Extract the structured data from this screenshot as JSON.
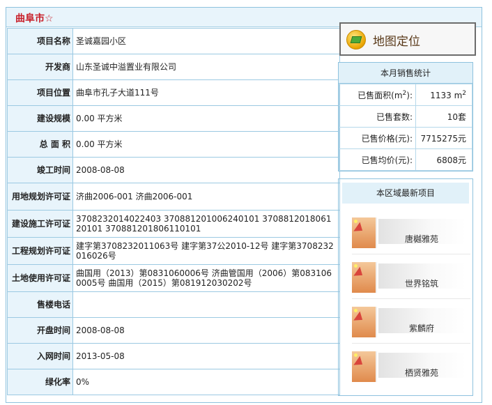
{
  "page": {
    "title": "曲阜市☆"
  },
  "info_rows": [
    {
      "label": "项目名称",
      "value": "圣诚嘉园小区"
    },
    {
      "label": "开发商",
      "value": "山东圣诚中溢置业有限公司"
    },
    {
      "label": "项目位置",
      "value": "曲阜市孔子大道111号"
    },
    {
      "label": "建设规模",
      "value": "0.00 平方米"
    },
    {
      "label": "总 面 积",
      "value": "0.00 平方米"
    },
    {
      "label": "竣工时间",
      "value": "2008-08-08"
    },
    {
      "label": "用地规划许可证",
      "value": "济曲2006-001 济曲2006-001"
    },
    {
      "label": "建设施工许可证",
      "value": "3708232014022403 370881201006240101 370881201806120101 370881201806110101"
    },
    {
      "label": "工程规划许可证",
      "value": "建字第3708232011063号 建字第37公2010-12号 建字第3708232016026号"
    },
    {
      "label": "土地使用许可证",
      "value": "曲国用（2013）第0831060006号 济曲管国用（2006）第0831060005号 曲国用（2015）第081912030202号"
    },
    {
      "label": "售楼电话",
      "value": ""
    },
    {
      "label": "开盘时间",
      "value": "2008-08-08"
    },
    {
      "label": "入网时间",
      "value": "2013-05-08"
    },
    {
      "label": "绿化率",
      "value": "0%"
    }
  ],
  "map_button": {
    "label": "地图定位",
    "icon": "map-locate-icon"
  },
  "sales_stats": {
    "title": "本月销售统计",
    "area_label_prefix": "已售面积(m",
    "area_label_sup": "2",
    "area_label_suffix": "):",
    "area_value": "1133 m",
    "area_value_sup": "2",
    "count_label": "已售套数:",
    "count_value": "10套",
    "price_label": "已售价格(元):",
    "price_value": "7715275元",
    "avg_label": "已售均价(元):",
    "avg_value": "6808元"
  },
  "latest_projects": {
    "title": "本区域最新项目",
    "items": [
      {
        "name": "唐樾雅苑"
      },
      {
        "name": "世界铭筑"
      },
      {
        "name": "紫麟府"
      },
      {
        "name": "栖贤雅苑"
      }
    ]
  }
}
